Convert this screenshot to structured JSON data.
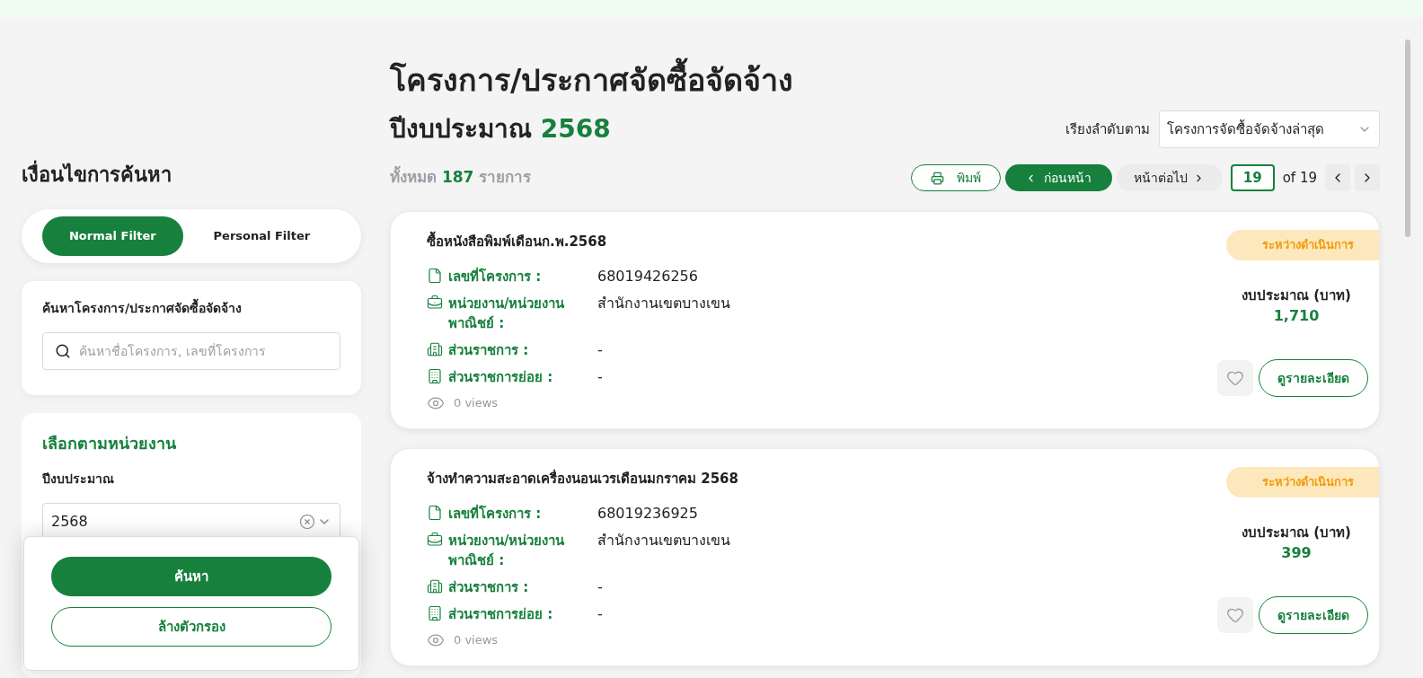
{
  "page": {
    "title": "โครงการ/ประกาศจัดซื้อจัดจ้าง",
    "fiscal_year_label": "ปีงบประมาณ",
    "fiscal_year": "2568",
    "total_prefix": "ทั้งหมด",
    "total": "187",
    "total_suffix": "รายการ"
  },
  "sort": {
    "label": "เรียงลำดับตาม",
    "value": "โครงการจัดซื้อจัดจ้างล่าสุด"
  },
  "toolbar": {
    "print": "พิมพ์",
    "prev": "ก่อนหน้า",
    "next": "หน้าต่อไป",
    "page": "19",
    "of": "of 19"
  },
  "sidebar": {
    "heading": "เงื่อนไขการค้นหา",
    "filter_tabs": [
      {
        "label": "Normal Filter",
        "selected": true
      },
      {
        "label": "Personal Filter",
        "selected": false
      }
    ],
    "search": {
      "title": "ค้นหาโครงการ/ประกาศจัดซื้อจัดจ้าง",
      "placeholder": "ค้นหาชื่อโครงการ, เลขที่โครงการ"
    },
    "unit": {
      "heading": "เลือกตามหน่วยงาน",
      "year_label": "ปีงบประมาณ",
      "year_value": "2568"
    }
  },
  "actions": {
    "search": "ค้นหา",
    "clear": "ล้างตัวกรอง"
  },
  "projects": [
    {
      "title": "ซื้อหนังสือพิมพ์เดือนก.พ.2568",
      "status": "ระหว่างดำเนินการ",
      "fields": [
        {
          "kind": "number",
          "label": "เลขที่โครงการ :",
          "value": "68019426256"
        },
        {
          "kind": "agency",
          "label": "หน่วยงาน/หน่วยงานพาณิชย์ :",
          "value": "สำนักงานเขตบางเขน"
        },
        {
          "kind": "department",
          "label": "ส่วนราชการ :",
          "value": "-"
        },
        {
          "kind": "subdepartment",
          "label": "ส่วนราชการย่อย :",
          "value": "-"
        }
      ],
      "views": "0 views",
      "budget_label": "งบประมาณ (บาท)",
      "budget": "1,710",
      "detail": "ดูรายละเอียด",
      "favorite": false
    },
    {
      "title": "จ้างทำความสะอาดเครื่องนอนเวรเดือนมกราคม 2568",
      "status": "ระหว่างดำเนินการ",
      "fields": [
        {
          "kind": "number",
          "label": "เลขที่โครงการ :",
          "value": "68019236925"
        },
        {
          "kind": "agency",
          "label": "หน่วยงาน/หน่วยงานพาณิชย์ :",
          "value": "สำนักงานเขตบางเขน"
        },
        {
          "kind": "department",
          "label": "ส่วนราชการ :",
          "value": "-"
        },
        {
          "kind": "subdepartment",
          "label": "ส่วนราชการย่อย :",
          "value": "-"
        }
      ],
      "views": "0 views",
      "budget_label": "งบประมาณ (บาท)",
      "budget": "399",
      "detail": "ดูรายละเอียด",
      "favorite": false
    }
  ]
}
